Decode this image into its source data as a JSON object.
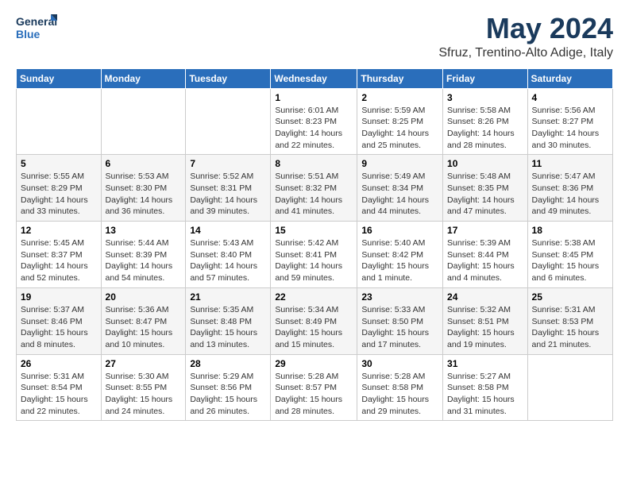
{
  "logo": {
    "line1": "General",
    "line2": "Blue"
  },
  "title": "May 2024",
  "subtitle": "Sfruz, Trentino-Alto Adige, Italy",
  "weekdays": [
    "Sunday",
    "Monday",
    "Tuesday",
    "Wednesday",
    "Thursday",
    "Friday",
    "Saturday"
  ],
  "weeks": [
    [
      {
        "day": "",
        "info": ""
      },
      {
        "day": "",
        "info": ""
      },
      {
        "day": "",
        "info": ""
      },
      {
        "day": "1",
        "info": "Sunrise: 6:01 AM\nSunset: 8:23 PM\nDaylight: 14 hours\nand 22 minutes."
      },
      {
        "day": "2",
        "info": "Sunrise: 5:59 AM\nSunset: 8:25 PM\nDaylight: 14 hours\nand 25 minutes."
      },
      {
        "day": "3",
        "info": "Sunrise: 5:58 AM\nSunset: 8:26 PM\nDaylight: 14 hours\nand 28 minutes."
      },
      {
        "day": "4",
        "info": "Sunrise: 5:56 AM\nSunset: 8:27 PM\nDaylight: 14 hours\nand 30 minutes."
      }
    ],
    [
      {
        "day": "5",
        "info": "Sunrise: 5:55 AM\nSunset: 8:29 PM\nDaylight: 14 hours\nand 33 minutes."
      },
      {
        "day": "6",
        "info": "Sunrise: 5:53 AM\nSunset: 8:30 PM\nDaylight: 14 hours\nand 36 minutes."
      },
      {
        "day": "7",
        "info": "Sunrise: 5:52 AM\nSunset: 8:31 PM\nDaylight: 14 hours\nand 39 minutes."
      },
      {
        "day": "8",
        "info": "Sunrise: 5:51 AM\nSunset: 8:32 PM\nDaylight: 14 hours\nand 41 minutes."
      },
      {
        "day": "9",
        "info": "Sunrise: 5:49 AM\nSunset: 8:34 PM\nDaylight: 14 hours\nand 44 minutes."
      },
      {
        "day": "10",
        "info": "Sunrise: 5:48 AM\nSunset: 8:35 PM\nDaylight: 14 hours\nand 47 minutes."
      },
      {
        "day": "11",
        "info": "Sunrise: 5:47 AM\nSunset: 8:36 PM\nDaylight: 14 hours\nand 49 minutes."
      }
    ],
    [
      {
        "day": "12",
        "info": "Sunrise: 5:45 AM\nSunset: 8:37 PM\nDaylight: 14 hours\nand 52 minutes."
      },
      {
        "day": "13",
        "info": "Sunrise: 5:44 AM\nSunset: 8:39 PM\nDaylight: 14 hours\nand 54 minutes."
      },
      {
        "day": "14",
        "info": "Sunrise: 5:43 AM\nSunset: 8:40 PM\nDaylight: 14 hours\nand 57 minutes."
      },
      {
        "day": "15",
        "info": "Sunrise: 5:42 AM\nSunset: 8:41 PM\nDaylight: 14 hours\nand 59 minutes."
      },
      {
        "day": "16",
        "info": "Sunrise: 5:40 AM\nSunset: 8:42 PM\nDaylight: 15 hours\nand 1 minute."
      },
      {
        "day": "17",
        "info": "Sunrise: 5:39 AM\nSunset: 8:44 PM\nDaylight: 15 hours\nand 4 minutes."
      },
      {
        "day": "18",
        "info": "Sunrise: 5:38 AM\nSunset: 8:45 PM\nDaylight: 15 hours\nand 6 minutes."
      }
    ],
    [
      {
        "day": "19",
        "info": "Sunrise: 5:37 AM\nSunset: 8:46 PM\nDaylight: 15 hours\nand 8 minutes."
      },
      {
        "day": "20",
        "info": "Sunrise: 5:36 AM\nSunset: 8:47 PM\nDaylight: 15 hours\nand 10 minutes."
      },
      {
        "day": "21",
        "info": "Sunrise: 5:35 AM\nSunset: 8:48 PM\nDaylight: 15 hours\nand 13 minutes."
      },
      {
        "day": "22",
        "info": "Sunrise: 5:34 AM\nSunset: 8:49 PM\nDaylight: 15 hours\nand 15 minutes."
      },
      {
        "day": "23",
        "info": "Sunrise: 5:33 AM\nSunset: 8:50 PM\nDaylight: 15 hours\nand 17 minutes."
      },
      {
        "day": "24",
        "info": "Sunrise: 5:32 AM\nSunset: 8:51 PM\nDaylight: 15 hours\nand 19 minutes."
      },
      {
        "day": "25",
        "info": "Sunrise: 5:31 AM\nSunset: 8:53 PM\nDaylight: 15 hours\nand 21 minutes."
      }
    ],
    [
      {
        "day": "26",
        "info": "Sunrise: 5:31 AM\nSunset: 8:54 PM\nDaylight: 15 hours\nand 22 minutes."
      },
      {
        "day": "27",
        "info": "Sunrise: 5:30 AM\nSunset: 8:55 PM\nDaylight: 15 hours\nand 24 minutes."
      },
      {
        "day": "28",
        "info": "Sunrise: 5:29 AM\nSunset: 8:56 PM\nDaylight: 15 hours\nand 26 minutes."
      },
      {
        "day": "29",
        "info": "Sunrise: 5:28 AM\nSunset: 8:57 PM\nDaylight: 15 hours\nand 28 minutes."
      },
      {
        "day": "30",
        "info": "Sunrise: 5:28 AM\nSunset: 8:58 PM\nDaylight: 15 hours\nand 29 minutes."
      },
      {
        "day": "31",
        "info": "Sunrise: 5:27 AM\nSunset: 8:58 PM\nDaylight: 15 hours\nand 31 minutes."
      },
      {
        "day": "",
        "info": ""
      }
    ]
  ]
}
